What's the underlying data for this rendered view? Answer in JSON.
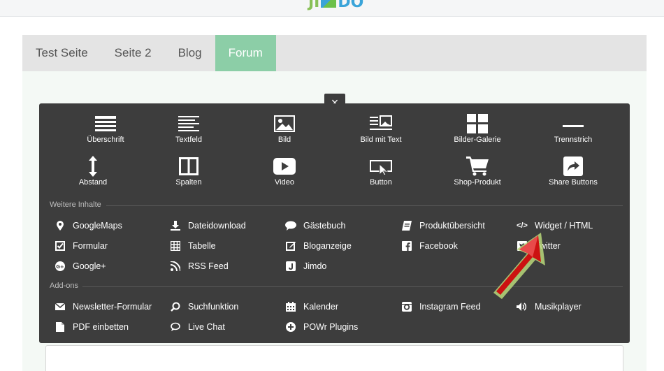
{
  "brand": {
    "logo_left": "JI",
    "logo_right": "DO"
  },
  "nav": {
    "tabs": [
      {
        "label": "Test Seite",
        "active": false
      },
      {
        "label": "Seite 2",
        "active": false
      },
      {
        "label": "Blog",
        "active": false
      },
      {
        "label": "Forum",
        "active": true
      }
    ]
  },
  "panel": {
    "close_label": "×",
    "grid": [
      {
        "label": "Überschrift",
        "icon": "heading-icon"
      },
      {
        "label": "Textfeld",
        "icon": "text-icon"
      },
      {
        "label": "Bild",
        "icon": "image-icon"
      },
      {
        "label": "Bild mit Text",
        "icon": "image-text-icon"
      },
      {
        "label": "Bilder-Galerie",
        "icon": "gallery-icon"
      },
      {
        "label": "Trennstrich",
        "icon": "divider-icon"
      },
      {
        "label": "Abstand",
        "icon": "spacing-icon"
      },
      {
        "label": "Spalten",
        "icon": "columns-icon"
      },
      {
        "label": "Video",
        "icon": "video-icon"
      },
      {
        "label": "Button",
        "icon": "button-icon"
      },
      {
        "label": "Shop-Produkt",
        "icon": "cart-icon"
      },
      {
        "label": "Share Buttons",
        "icon": "share-icon"
      }
    ],
    "more_label": "Weitere Inhalte",
    "more": [
      {
        "label": "GoogleMaps",
        "icon": "map-pin-icon"
      },
      {
        "label": "Dateidownload",
        "icon": "download-icon"
      },
      {
        "label": "Gästebuch",
        "icon": "speech-bubble-icon"
      },
      {
        "label": "Produktübersicht",
        "icon": "book-icon"
      },
      {
        "label": "Widget / HTML",
        "icon": "code-icon"
      },
      {
        "label": "Formular",
        "icon": "checkbox-icon"
      },
      {
        "label": "Tabelle",
        "icon": "table-icon"
      },
      {
        "label": "Bloganzeige",
        "icon": "edit-icon"
      },
      {
        "label": "Facebook",
        "icon": "facebook-icon"
      },
      {
        "label": "Twitter",
        "icon": "twitter-icon"
      },
      {
        "label": "Google+",
        "icon": "google-plus-icon"
      },
      {
        "label": "RSS Feed",
        "icon": "rss-icon"
      },
      {
        "label": "Jimdo",
        "icon": "jimdo-icon"
      }
    ],
    "addons_label": "Add-ons",
    "addons": [
      {
        "label": "Newsletter-Formular",
        "icon": "envelope-icon"
      },
      {
        "label": "Suchfunktion",
        "icon": "search-icon"
      },
      {
        "label": "Kalender",
        "icon": "calendar-icon"
      },
      {
        "label": "Instagram Feed",
        "icon": "camera-icon"
      },
      {
        "label": "Musikplayer",
        "icon": "speaker-icon"
      },
      {
        "label": "PDF einbetten",
        "icon": "pdf-icon"
      },
      {
        "label": "Live Chat",
        "icon": "chat-icon"
      },
      {
        "label": "POWr Plugins",
        "icon": "plus-circle-icon"
      }
    ]
  },
  "colors": {
    "accent": "#8ccea7",
    "panel": "#3d3d3d",
    "arrow": "#cc1111"
  }
}
